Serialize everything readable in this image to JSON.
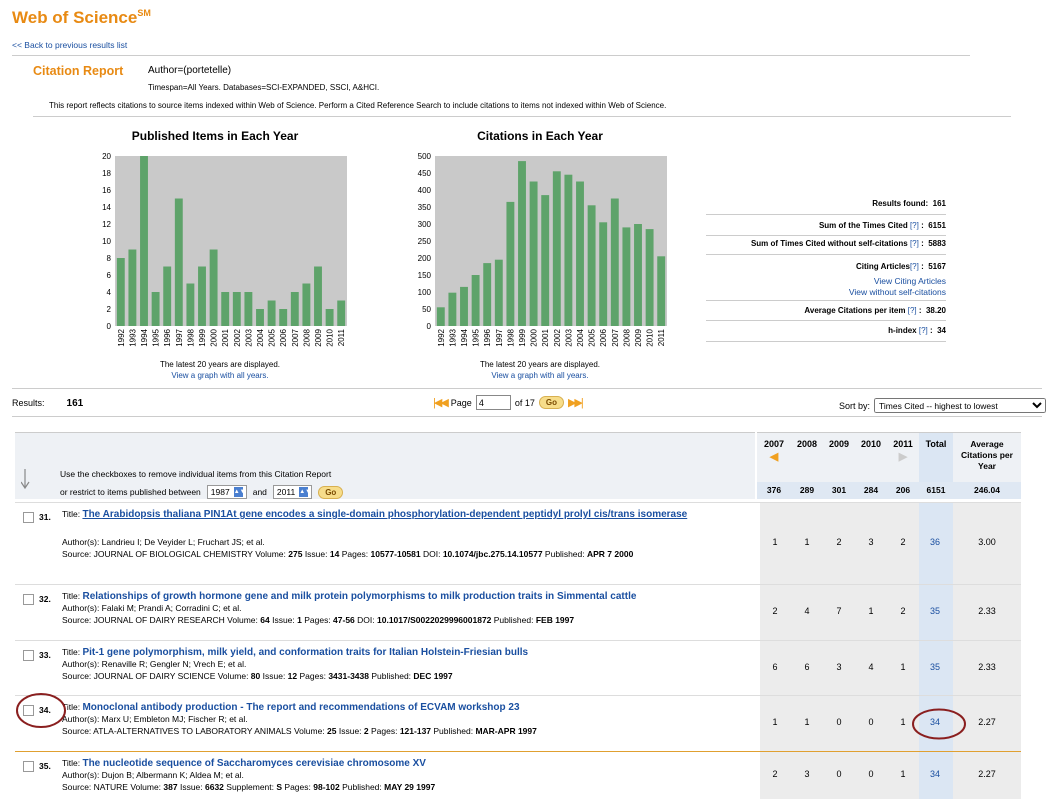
{
  "brand": {
    "name": "Web of Science",
    "mark": "SM"
  },
  "nav": {
    "back": "<< Back to previous results list"
  },
  "report": {
    "title": "Citation Report",
    "query": "Author=(portetelle)",
    "timespan": "Timespan=All Years. Databases=SCI-EXPANDED, SSCI, A&HCI.",
    "note": "This report reflects citations to source items indexed within Web of Science. Perform a Cited Reference Search to include citations to items not indexed within Web of Science."
  },
  "chart_data": [
    {
      "type": "bar",
      "title": "Published Items in Each Year",
      "categories": [
        "1992",
        "1993",
        "1994",
        "1995",
        "1996",
        "1997",
        "1998",
        "1999",
        "2000",
        "2001",
        "2002",
        "2003",
        "2004",
        "2005",
        "2006",
        "2007",
        "2008",
        "2009",
        "2010",
        "2011"
      ],
      "values": [
        8,
        9,
        20,
        4,
        7,
        15,
        5,
        7,
        9,
        4,
        4,
        4,
        2,
        3,
        2,
        4,
        5,
        7,
        2,
        3
      ],
      "ylim": [
        0,
        20
      ],
      "yticks": [
        0,
        2,
        4,
        6,
        8,
        10,
        12,
        14,
        16,
        18,
        20
      ],
      "color": "#5ea36a",
      "background": "#c9c9c9",
      "note": "The latest 20 years are displayed.",
      "link": "View a graph with all years."
    },
    {
      "type": "bar",
      "title": "Citations in Each Year",
      "categories": [
        "1992",
        "1993",
        "1994",
        "1995",
        "1996",
        "1997",
        "1998",
        "1999",
        "2000",
        "2001",
        "2002",
        "2003",
        "2004",
        "2005",
        "2006",
        "2007",
        "2008",
        "2009",
        "2010",
        "2011"
      ],
      "values": [
        55,
        98,
        115,
        150,
        185,
        195,
        365,
        485,
        425,
        385,
        455,
        445,
        425,
        355,
        305,
        375,
        290,
        300,
        285,
        205
      ],
      "ylim": [
        0,
        500
      ],
      "yticks": [
        0,
        50,
        100,
        150,
        200,
        250,
        300,
        350,
        400,
        450,
        500
      ],
      "color": "#5ea36a",
      "background": "#c9c9c9",
      "note": "The latest 20 years are displayed.",
      "link": "View a graph with all years."
    }
  ],
  "stats": {
    "results_found_label": "Results found:",
    "results_found": "161",
    "sum_label": "Sum of the Times Cited",
    "sum": "6151",
    "sum_wo_label": "Sum of Times Cited without self-citations",
    "sum_wo": "5883",
    "citing_label": "Citing Articles",
    "citing": "5167",
    "view_citing": "View Citing Articles",
    "view_wo": "View without self-citations",
    "avg_label": "Average Citations per item",
    "avg": "38.20",
    "h_label": "h-index",
    "h": "34",
    "help": "[?]"
  },
  "toolbar": {
    "results_label": "Results:",
    "results": "161",
    "page_label": "Page",
    "page_value": "4",
    "of_label": "of 17",
    "go": "Go",
    "sort_label": "Sort by:",
    "sort_value": "Times Cited -- highest to lowest"
  },
  "table": {
    "help1": "Use the checkboxes to remove individual items from this Citation Report",
    "help2": "or restrict to items published between",
    "from_year": "1987",
    "and": "and",
    "to_year": "2011",
    "go": "Go",
    "years": [
      "2007",
      "2008",
      "2009",
      "2010",
      "2011"
    ],
    "total_label": "Total",
    "avg_label": "Average Citations per Year",
    "sums": [
      "376",
      "289",
      "301",
      "284",
      "206",
      "6151",
      "246.04"
    ],
    "rows": [
      {
        "num": "31.",
        "title_label": "Title:",
        "title": "The Arabidopsis thaliana PIN1At gene encodes a single-domain phosphorylation-dependent peptidyl prolyl cis/trans isomerase",
        "authors": "Author(s): Landrieu I; De Veyider L; Fruchart JS; et al.",
        "source": "Source: JOURNAL OF BIOLOGICAL CHEMISTRY  Volume:",
        "volume": "275",
        "issue_label": "Issue:",
        "issue": "14",
        "pages_label": "Pages:",
        "pages": "10577-10581",
        "doi_label": "DOI:",
        "doi": "10.1074/jbc.275.14.10577",
        "pub_label": "Published:",
        "published": "APR 7 2000",
        "cites": [
          "1",
          "1",
          "2",
          "3",
          "2"
        ],
        "total": "36",
        "avg": "3.00"
      },
      {
        "num": "32.",
        "title_label": "Title:",
        "title": "Relationships of growth hormone gene and milk protein polymorphisms to milk production traits in Simmental cattle",
        "authors": "Author(s): Falaki M; Prandi A; Corradini C; et al.",
        "source": "Source: JOURNAL OF DAIRY RESEARCH  Volume:",
        "volume": "64",
        "issue_label": "Issue:",
        "issue": "1",
        "pages_label": "Pages:",
        "pages": "47-56",
        "doi_label": "DOI:",
        "doi": "10.1017/S0022029996001872",
        "pub_label": "Published:",
        "published": "FEB 1997",
        "cites": [
          "2",
          "4",
          "7",
          "1",
          "2"
        ],
        "total": "35",
        "avg": "2.33"
      },
      {
        "num": "33.",
        "title_label": "Title:",
        "title": "Pit-1 gene polymorphism, milk yield, and conformation traits for Italian Holstein-Friesian bulls",
        "authors": "Author(s): Renaville R; Gengler N; Vrech E; et al.",
        "source": "Source: JOURNAL OF DAIRY SCIENCE  Volume:",
        "volume": "80",
        "issue_label": "Issue:",
        "issue": "12",
        "pages_label": "Pages:",
        "pages": "3431-3438",
        "pub_label": "Published:",
        "published": "DEC 1997",
        "cites": [
          "6",
          "6",
          "3",
          "4",
          "1"
        ],
        "total": "35",
        "avg": "2.33"
      },
      {
        "num": "34.",
        "title_label": "Title:",
        "title": "Monoclonal antibody production - The report and recommendations of ECVAM workshop 23",
        "authors": "Author(s): Marx U; Embleton MJ; Fischer R; et al.",
        "source": "Source: ATLA-ALTERNATIVES TO LABORATORY ANIMALS  Volume:",
        "volume": "25",
        "issue_label": "Issue:",
        "issue": "2",
        "pages_label": "Pages:",
        "pages": "121-137",
        "pub_label": "Published:",
        "published": "MAR-APR 1997",
        "cites": [
          "1",
          "1",
          "0",
          "0",
          "1"
        ],
        "total": "34",
        "avg": "2.27"
      },
      {
        "num": "35.",
        "title_label": "Title:",
        "title": "The nucleotide sequence of Saccharomyces cerevisiae chromosome XV",
        "authors": "Author(s): Dujon B; Albermann K; Aldea M; et al.",
        "source": "Source: NATURE  Volume:",
        "volume": "387",
        "issue_label": "Issue:",
        "issue": "6632",
        "supp_label": "Supplement:",
        "supp": "S",
        "pages_label": "Pages:",
        "pages": "98-102",
        "pub_label": "Published:",
        "published": "MAY 29 1997",
        "cites": [
          "2",
          "3",
          "0",
          "0",
          "1"
        ],
        "total": "34",
        "avg": "2.27"
      }
    ]
  },
  "colors": {
    "brand": "#e88a13",
    "link": "#1a4fa0",
    "bar": "#5ea36a",
    "annotation": "#8a1f1f"
  }
}
